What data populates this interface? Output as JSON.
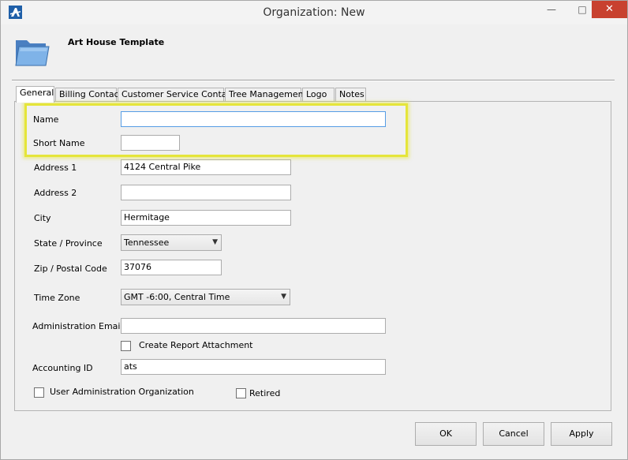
{
  "window": {
    "title": "Organization: New",
    "minimize": "—",
    "maximize": "□",
    "close": "✕"
  },
  "header": {
    "title": "Art House Template"
  },
  "tabs": [
    "General",
    "Billing Contact",
    "Customer Service Contact",
    "Tree Management",
    "Logo",
    "Notes"
  ],
  "form": {
    "name_label": "Name",
    "name_value": "",
    "short_name_label": "Short Name",
    "short_name_value": "",
    "address1_label": "Address 1",
    "address1_value": "4124 Central Pike",
    "address2_label": "Address 2",
    "address2_value": "",
    "city_label": "City",
    "city_value": "Hermitage",
    "state_label": "State / Province",
    "state_value": "Tennessee",
    "zip_label": "Zip / Postal Code",
    "zip_value": "37076",
    "timezone_label": "Time Zone",
    "timezone_value": "GMT -6:00, Central Time",
    "admin_email_label": "Administration Email",
    "admin_email_value": "",
    "report_attachment_label": "Create Report Attachment",
    "accounting_id_label": "Accounting ID",
    "accounting_id_value": "ats",
    "user_admin_org_label": "User Administration Organization",
    "retired_label": "Retired"
  },
  "buttons": {
    "ok": "OK",
    "cancel": "Cancel",
    "apply": "Apply"
  },
  "colors": {
    "highlight": "#e5e53a",
    "close_button": "#c8412f",
    "focus_border": "#569de5"
  }
}
